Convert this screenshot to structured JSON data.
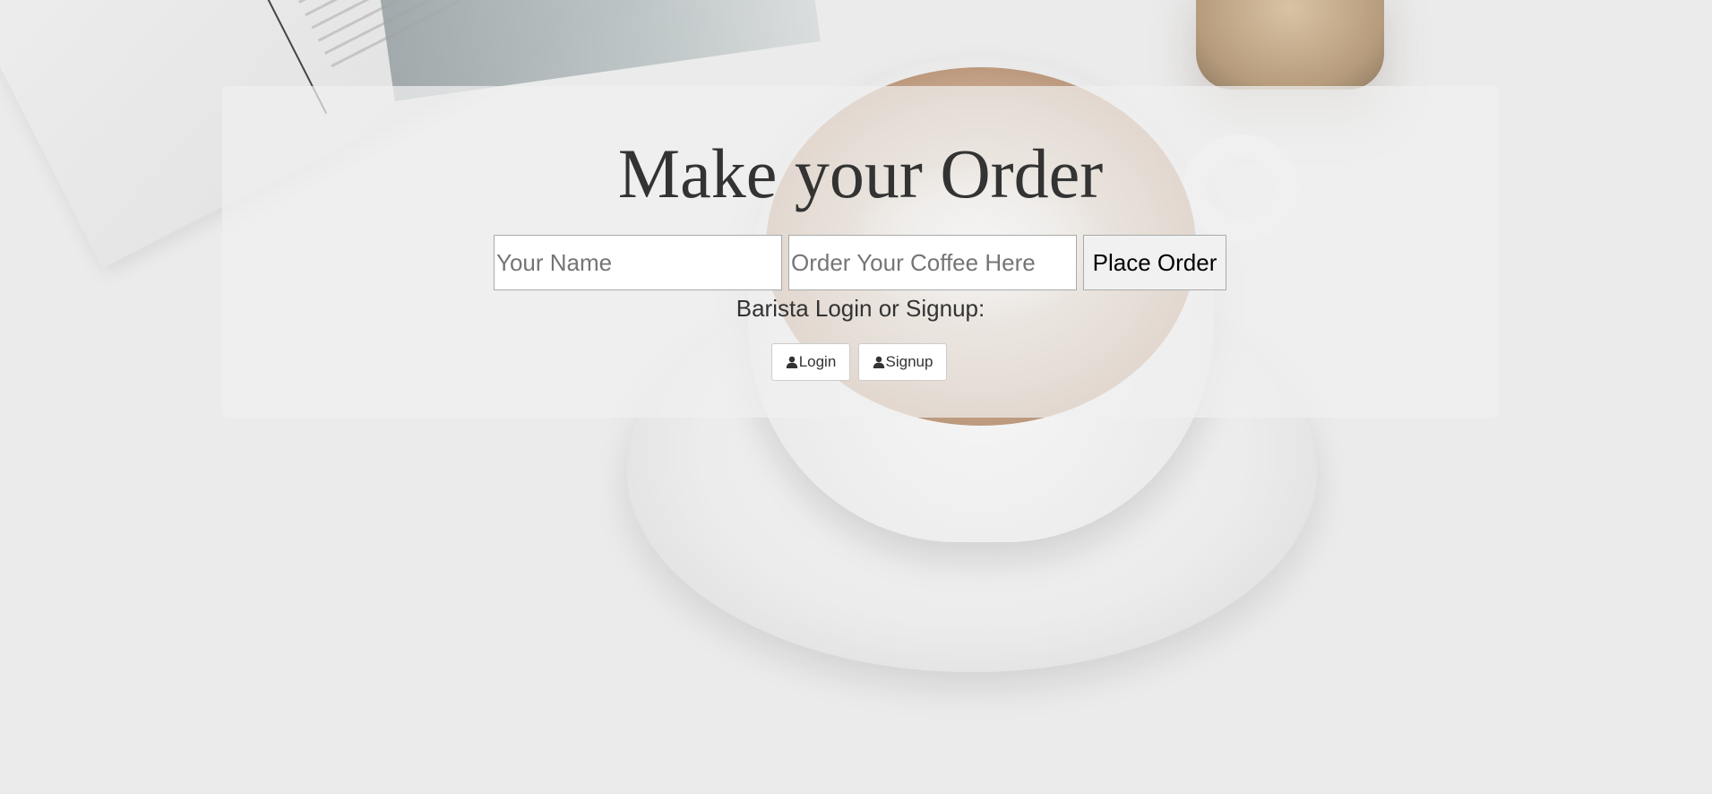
{
  "hero": {
    "title": "Make your Order"
  },
  "order_form": {
    "name_placeholder": "Your Name",
    "coffee_placeholder": "Order Your Coffee Here",
    "submit_label": "Place Order"
  },
  "barista": {
    "prompt": "Barista Login or Signup:",
    "login_label": "Login",
    "signup_label": "Signup",
    "icon": "user-icon"
  },
  "colors": {
    "panel_background": "#f0f0f0",
    "title_color": "#333333"
  }
}
